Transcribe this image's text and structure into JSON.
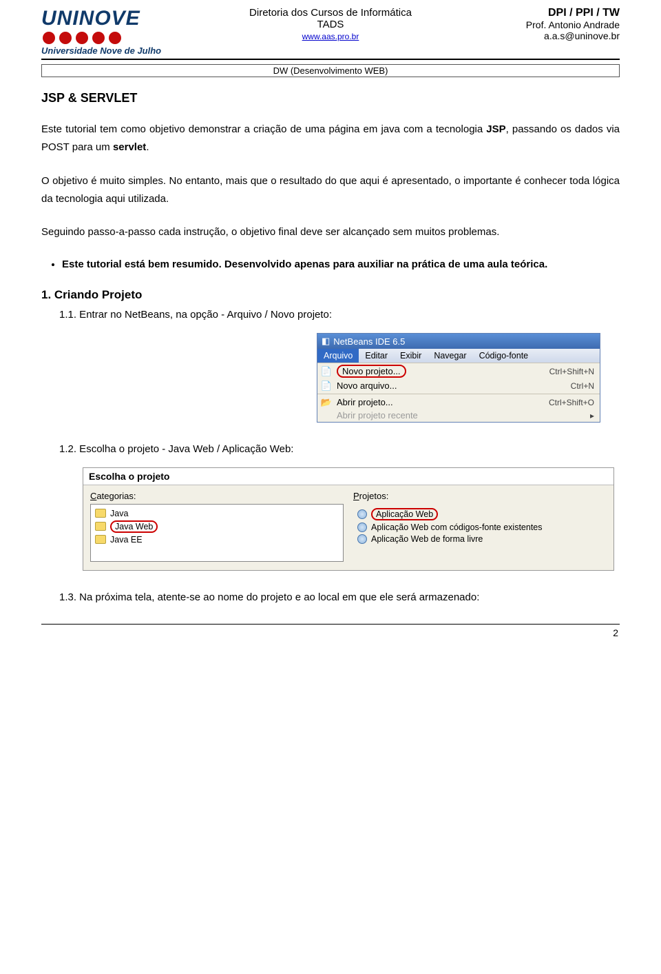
{
  "header": {
    "logo_main": "UNINOVE",
    "logo_sub": "Universidade Nove de Julho",
    "center_line1": "Diretoria dos Cursos de Informática",
    "center_line2": "TADS",
    "center_link": "www.aas.pro.br",
    "right_line1": "DPI  / PPI / TW",
    "right_line2": "Prof. Antonio Andrade",
    "right_line3": "a.a.s@uninove.br",
    "subhead": "DW (Desenvolvimento WEB)"
  },
  "content": {
    "h1": "JSP & SERVLET",
    "p1_a": "Este tutorial tem como objetivo demonstrar a criação de uma página em java com a tecnologia ",
    "p1_bold1": "JSP",
    "p1_b": ", passando os dados via POST para um ",
    "p1_bold2": "servlet",
    "p1_c": ".",
    "p2": "O objetivo é muito simples. No entanto, mais que o resultado do que aqui é apresentado, o importante é conhecer toda lógica da tecnologia aqui utilizada.",
    "p3": "Seguindo passo-a-passo cada instrução, o objetivo final deve ser alcançado sem muitos problemas.",
    "bullet1": "Este tutorial está bem resumido. Desenvolvido apenas para auxiliar na prática de uma aula teórica.",
    "h2_1": "1. Criando Projeto",
    "step_1_1": "1.1. Entrar no NetBeans, na opção - Arquivo / Novo projeto:",
    "step_1_2": "1.2. Escolha o projeto - Java Web / Aplicação Web:",
    "step_1_3": "1.3. Na próxima tela, atente-se ao nome do projeto e ao local em que ele será armazenado:"
  },
  "netbeans": {
    "title": "NetBeans IDE 6.5",
    "menus": [
      "Arquivo",
      "Editar",
      "Exibir",
      "Navegar",
      "Código-fonte"
    ],
    "items": [
      {
        "icon": "new-project-icon",
        "label": "Novo projeto...",
        "shortcut": "Ctrl+Shift+N",
        "highlight": true
      },
      {
        "icon": "new-file-icon",
        "label": "Novo arquivo...",
        "shortcut": "Ctrl+N"
      },
      {
        "sep": true
      },
      {
        "icon": "open-project-icon",
        "label": "Abrir projeto...",
        "shortcut": "Ctrl+Shift+O"
      },
      {
        "icon": "",
        "label": "Abrir projeto recente",
        "shortcut": "",
        "disabled": true,
        "submenu": true
      }
    ]
  },
  "wizard": {
    "title": "Escolha o projeto",
    "left_label": "Categorias:",
    "right_label": "Projetos:",
    "categories": [
      "Java",
      "Java Web",
      "Java EE"
    ],
    "selected_category": "Java Web",
    "projects": [
      "Aplicação Web",
      "Aplicação Web com códigos-fonte existentes",
      "Aplicação Web de forma livre"
    ],
    "selected_project": "Aplicação Web"
  },
  "page_number": "2"
}
